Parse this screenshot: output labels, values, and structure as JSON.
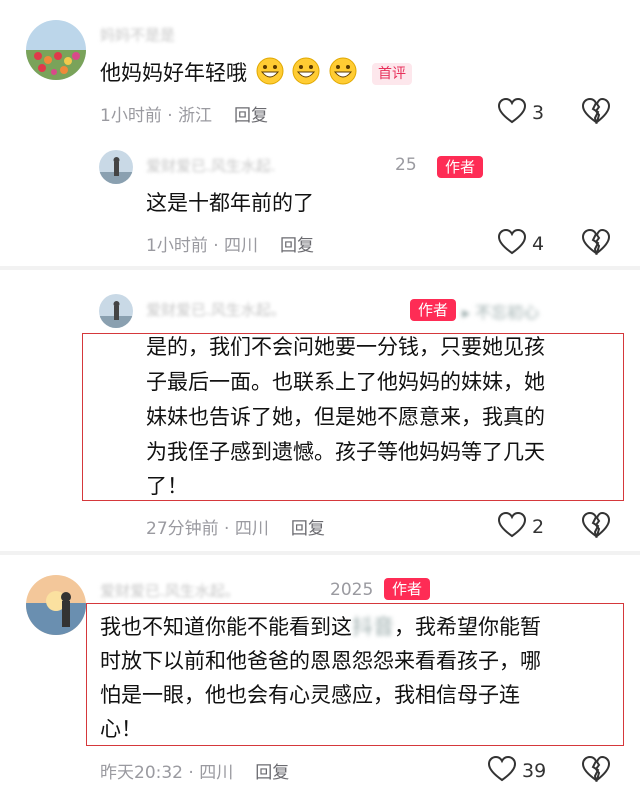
{
  "comment1": {
    "username": "妈妈不是是",
    "text": "他妈妈好年轻哦",
    "badge": "首评",
    "time": "1小时前",
    "location": "浙江",
    "reply": "回复",
    "likes": "3"
  },
  "reply1": {
    "username": "爱财爱已.风生水起.",
    "extra": "25",
    "badge": "作者",
    "text": "这是十都年前的了",
    "time": "1小时前",
    "location": "四川",
    "reply": "回复",
    "likes": "4"
  },
  "reply2": {
    "username": "爱财爱已.风生水起。",
    "extra": "▸ 不忘初心",
    "badge": "作者",
    "lines": [
      "是的，我们不会问她要一分钱，只要她见孩",
      "子最后一面。也联系上了他妈妈的妹妹，她",
      "妹妹也告诉了她，但是她不愿意来，我真的",
      "为我侄子感到遗憾。孩子等他妈妈等了几天",
      "了！"
    ],
    "time": "27分钟前",
    "location": "四川",
    "reply": "回复",
    "likes": "2"
  },
  "comment2": {
    "username": "爱财爱已.风生水起。",
    "extra": "2025",
    "badge": "作者",
    "lines": [
      "我也不知道你能不能看到这",
      "时放下以前和他爸爸的恩恩怨怨来看看孩子，哪",
      "怕是一眼，他也会有心灵感应，我相信母子连",
      "心！"
    ],
    "line1_blurred": "抖音",
    "line1_tail": "，我希望你能暂",
    "time": "昨天20:32",
    "location": "四川",
    "reply": "回复",
    "likes": "39"
  }
}
